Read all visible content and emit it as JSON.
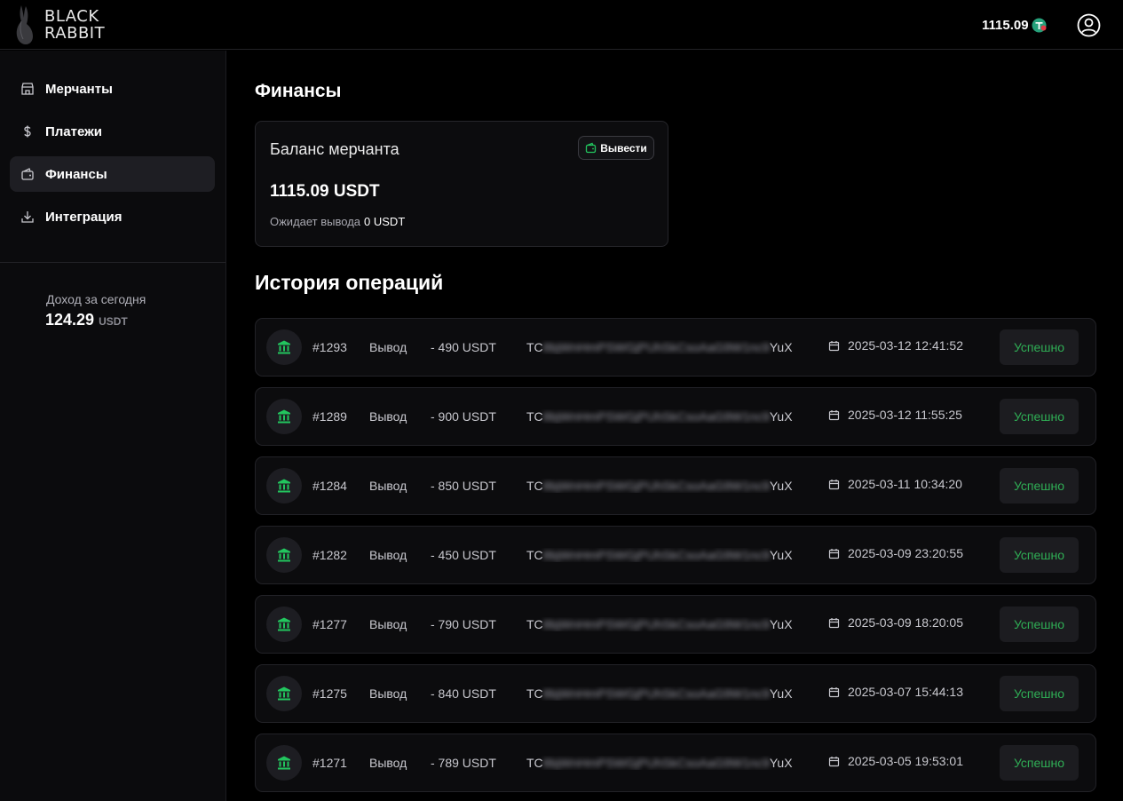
{
  "brand": {
    "line1": "BLACK",
    "line2": "RABBIT",
    "logo_icon": "rabbit-logo-icon"
  },
  "header": {
    "balance": "1115.09",
    "currency_icon": "tether-icon",
    "profile_icon": "user-circle-icon"
  },
  "sidebar": {
    "items": [
      {
        "label": "Мерчанты",
        "icon": "store-icon",
        "active": false
      },
      {
        "label": "Платежи",
        "icon": "dollar-icon",
        "active": false
      },
      {
        "label": "Финансы",
        "icon": "wallet-icon",
        "active": true
      },
      {
        "label": "Интеграция",
        "icon": "download-icon",
        "active": false
      }
    ],
    "income": {
      "label": "Доход за сегодня",
      "value": "124.29",
      "currency": "USDT"
    }
  },
  "main": {
    "title": "Финансы",
    "balance_card": {
      "title": "Баланс мерчанта",
      "withdraw_label": "Вывести",
      "amount": "1115.09 USDT",
      "pending_label": "Ожидает вывода",
      "pending_value": "0 USDT"
    },
    "history_title": "История операций",
    "transactions": [
      {
        "id": "#1293",
        "type": "Вывод",
        "amount": "- 490 USDT",
        "addr_prefix": "TC",
        "addr_hidden": "8bjWnHmPSWGjPUhSkCsoAaG9W1nc9",
        "addr_suffix": "YuX",
        "date": "2025-03-12 12:41:52",
        "status": "Успешно"
      },
      {
        "id": "#1289",
        "type": "Вывод",
        "amount": "- 900 USDT",
        "addr_prefix": "TC",
        "addr_hidden": "8bjWnHmPSWGjPUhSkCsoAaG9W1nc9",
        "addr_suffix": "YuX",
        "date": "2025-03-12 11:55:25",
        "status": "Успешно"
      },
      {
        "id": "#1284",
        "type": "Вывод",
        "amount": "- 850 USDT",
        "addr_prefix": "TC",
        "addr_hidden": "8bjWnHmPSWGjPUhSkCsoAaG9W1nc9",
        "addr_suffix": "YuX",
        "date": "2025-03-11 10:34:20",
        "status": "Успешно"
      },
      {
        "id": "#1282",
        "type": "Вывод",
        "amount": "- 450 USDT",
        "addr_prefix": "TC",
        "addr_hidden": "8bjWnHmPSWGjPUhSkCsoAaG9W1nc9",
        "addr_suffix": "YuX",
        "date": "2025-03-09 23:20:55",
        "status": "Успешно"
      },
      {
        "id": "#1277",
        "type": "Вывод",
        "amount": "- 790 USDT",
        "addr_prefix": "TC",
        "addr_hidden": "8bjWnHmPSWGjPUhSkCsoAaG9W1nc9",
        "addr_suffix": "YuX",
        "date": "2025-03-09 18:20:05",
        "status": "Успешно"
      },
      {
        "id": "#1275",
        "type": "Вывод",
        "amount": "- 840 USDT",
        "addr_prefix": "TC",
        "addr_hidden": "8bjWnHmPSWGjPUhSkCsoAaG9W1nc9",
        "addr_suffix": "YuX",
        "date": "2025-03-07 15:44:13",
        "status": "Успешно"
      },
      {
        "id": "#1271",
        "type": "Вывод",
        "amount": "- 789 USDT",
        "addr_prefix": "TC",
        "addr_hidden": "8bjWnHmPSWGjPUhSkCsoAaG9W1nc9",
        "addr_suffix": "YuX",
        "date": "2025-03-05 19:53:01",
        "status": "Успешно"
      }
    ]
  },
  "colors": {
    "success": "#2fae55",
    "accent_icon": "#22c55e",
    "background": "#000000",
    "card": "#0c0c0e"
  }
}
